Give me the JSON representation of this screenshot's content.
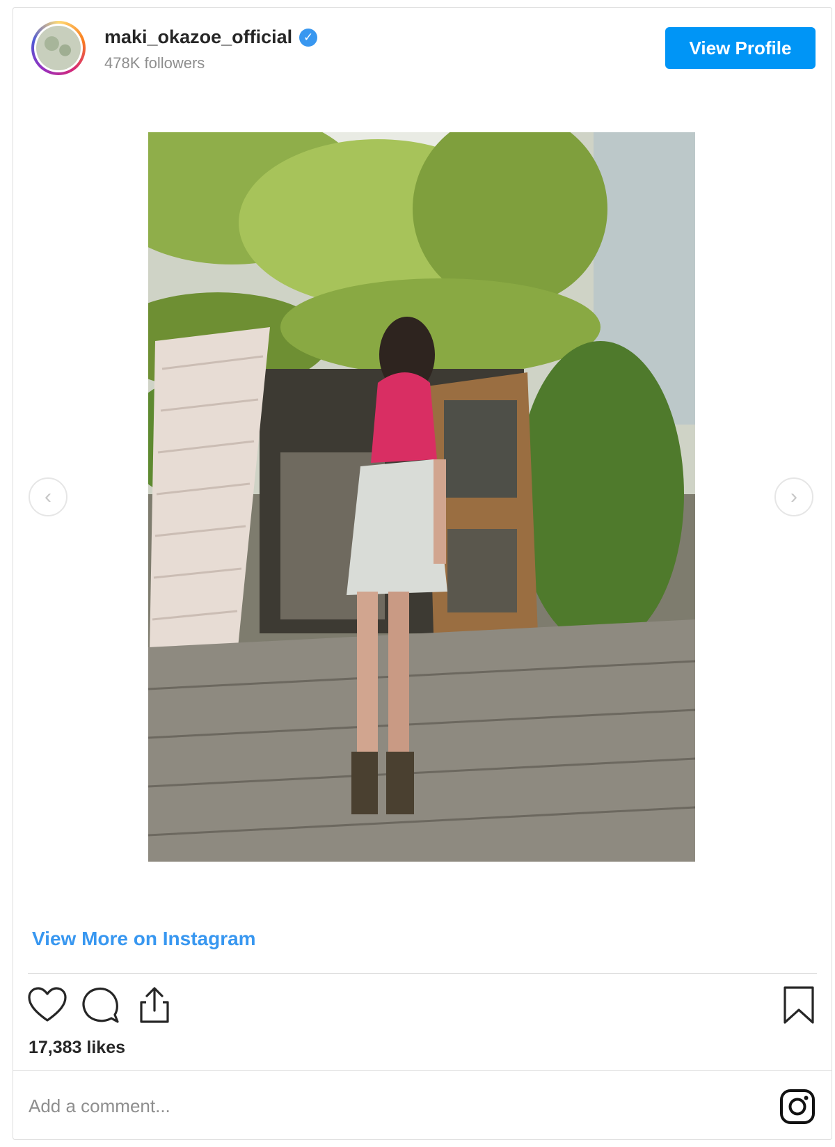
{
  "header": {
    "username": "maki_okazoe_official",
    "verified_icon": "verified-badge-icon",
    "followers": "478K followers",
    "view_profile_label": "View Profile"
  },
  "colors": {
    "accent": "#0095f6",
    "link": "#3897f0",
    "text": "#262626",
    "muted": "#8e8e8e"
  },
  "post": {
    "photo_icon": "photo",
    "prev_icon": "chevron-left-icon",
    "next_icon": "chevron-right-icon",
    "prev_glyph": "‹",
    "next_glyph": "›",
    "view_more_label": "View More on Instagram"
  },
  "actions": {
    "like_icon": "heart-icon",
    "comment_icon": "comment-icon",
    "share_icon": "share-icon",
    "bookmark_icon": "bookmark-icon",
    "likes_text": "17,383 likes"
  },
  "footer": {
    "comment_placeholder": "Add a comment...",
    "logo_icon": "instagram-logo-icon"
  }
}
